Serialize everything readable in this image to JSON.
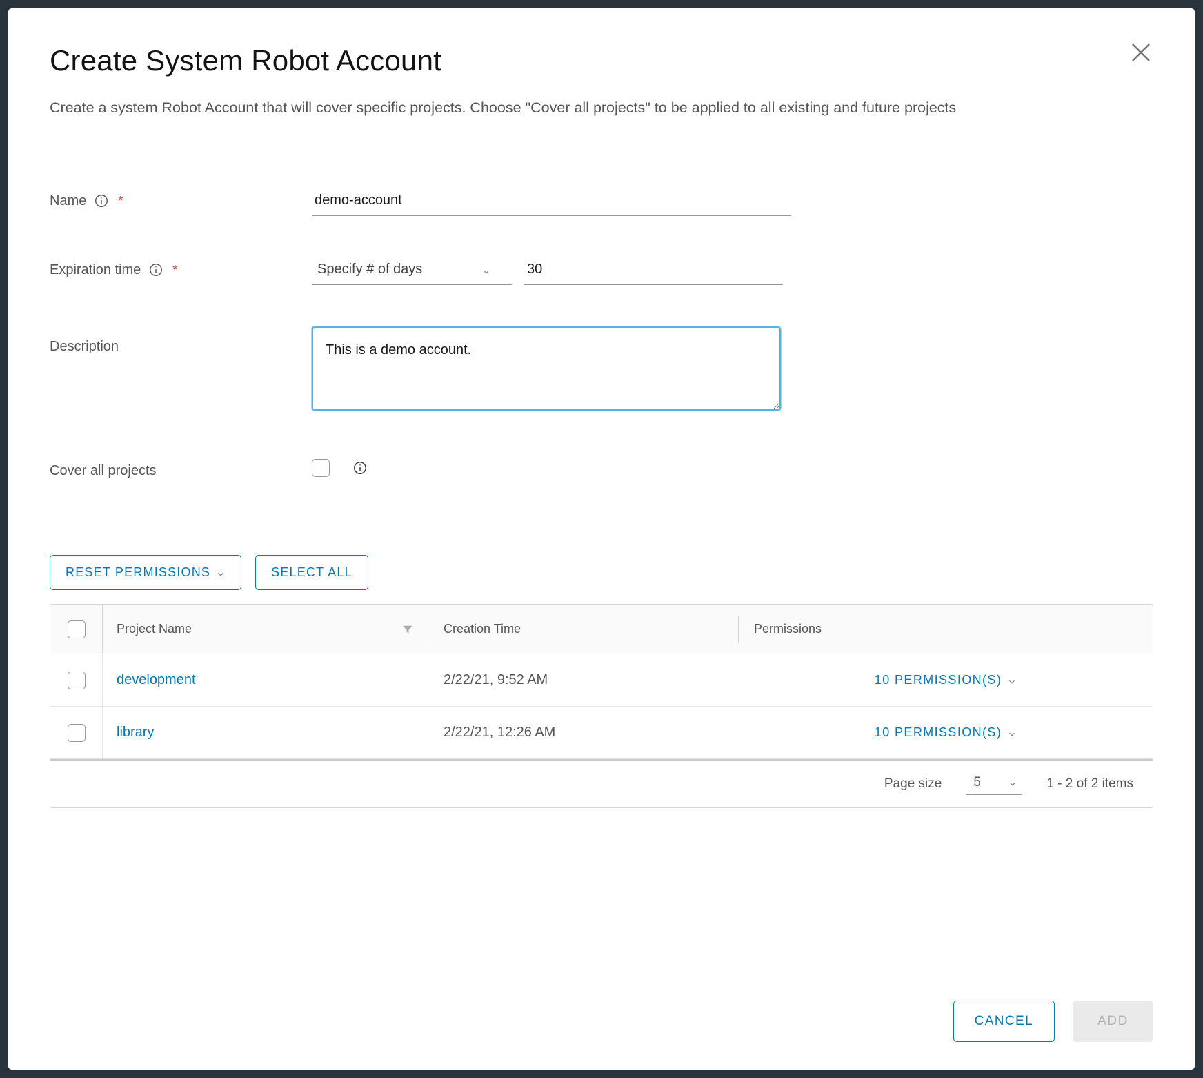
{
  "modal": {
    "title": "Create System Robot Account",
    "subtitle": "Create a system Robot Account that will cover specific projects. Choose \"Cover all projects\" to be applied to all existing and future projects"
  },
  "form": {
    "name": {
      "label": "Name",
      "value": "demo-account"
    },
    "expiration": {
      "label": "Expiration time",
      "mode_label": "Specify # of days",
      "days_value": "30"
    },
    "description": {
      "label": "Description",
      "value": "This is a demo account."
    },
    "cover_all": {
      "label": "Cover all projects"
    }
  },
  "buttons": {
    "reset_permissions": "RESET PERMISSIONS",
    "select_all": "SELECT ALL",
    "cancel": "CANCEL",
    "add": "ADD"
  },
  "table": {
    "headers": {
      "project_name": "Project Name",
      "creation_time": "Creation Time",
      "permissions": "Permissions"
    },
    "rows": [
      {
        "name": "development",
        "time": "2/22/21, 9:52 AM",
        "permissions": "10 PERMISSION(S)"
      },
      {
        "name": "library",
        "time": "2/22/21, 12:26 AM",
        "permissions": "10 PERMISSION(S)"
      }
    ],
    "footer": {
      "page_size_label": "Page size",
      "page_size_value": "5",
      "range": "1 - 2 of 2 items"
    }
  }
}
